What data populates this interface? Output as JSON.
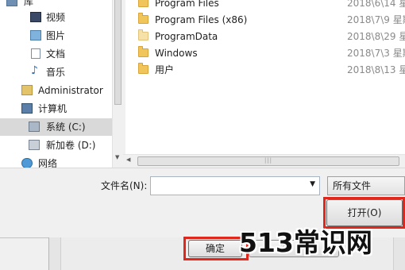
{
  "nav": {
    "items": [
      {
        "label": "库",
        "icon": "library-icon"
      },
      {
        "label": "视频",
        "icon": "video-icon"
      },
      {
        "label": "图片",
        "icon": "picture-icon"
      },
      {
        "label": "文档",
        "icon": "document-icon"
      },
      {
        "label": "音乐",
        "icon": "music-icon"
      },
      {
        "label": "Administrator",
        "icon": "user-folder-icon"
      },
      {
        "label": "计算机",
        "icon": "computer-icon"
      },
      {
        "label": "系统 (C:)",
        "icon": "drive-c-icon",
        "selected": true
      },
      {
        "label": "新加卷 (D:)",
        "icon": "drive-d-icon"
      },
      {
        "label": "网络",
        "icon": "network-icon"
      }
    ]
  },
  "files": [
    {
      "name": "Program Files",
      "date": "2018\\6\\14 星"
    },
    {
      "name": "Program Files (x86)",
      "date": "2018\\7\\9 星期"
    },
    {
      "name": "ProgramData",
      "date": "2018\\8\\29 星"
    },
    {
      "name": "Windows",
      "date": "2018\\7\\3 星期"
    },
    {
      "name": "用户",
      "date": "2018\\8\\13 星"
    }
  ],
  "filename": {
    "label": "文件名(N):",
    "value": ""
  },
  "filter": {
    "selected": "所有文件"
  },
  "buttons": {
    "open": "打开(O)",
    "confirm": "确定",
    "cancel": "消"
  },
  "watermark": "513常识网",
  "colors": {
    "highlight": "#e1261c",
    "folder": "#f0c65a"
  }
}
